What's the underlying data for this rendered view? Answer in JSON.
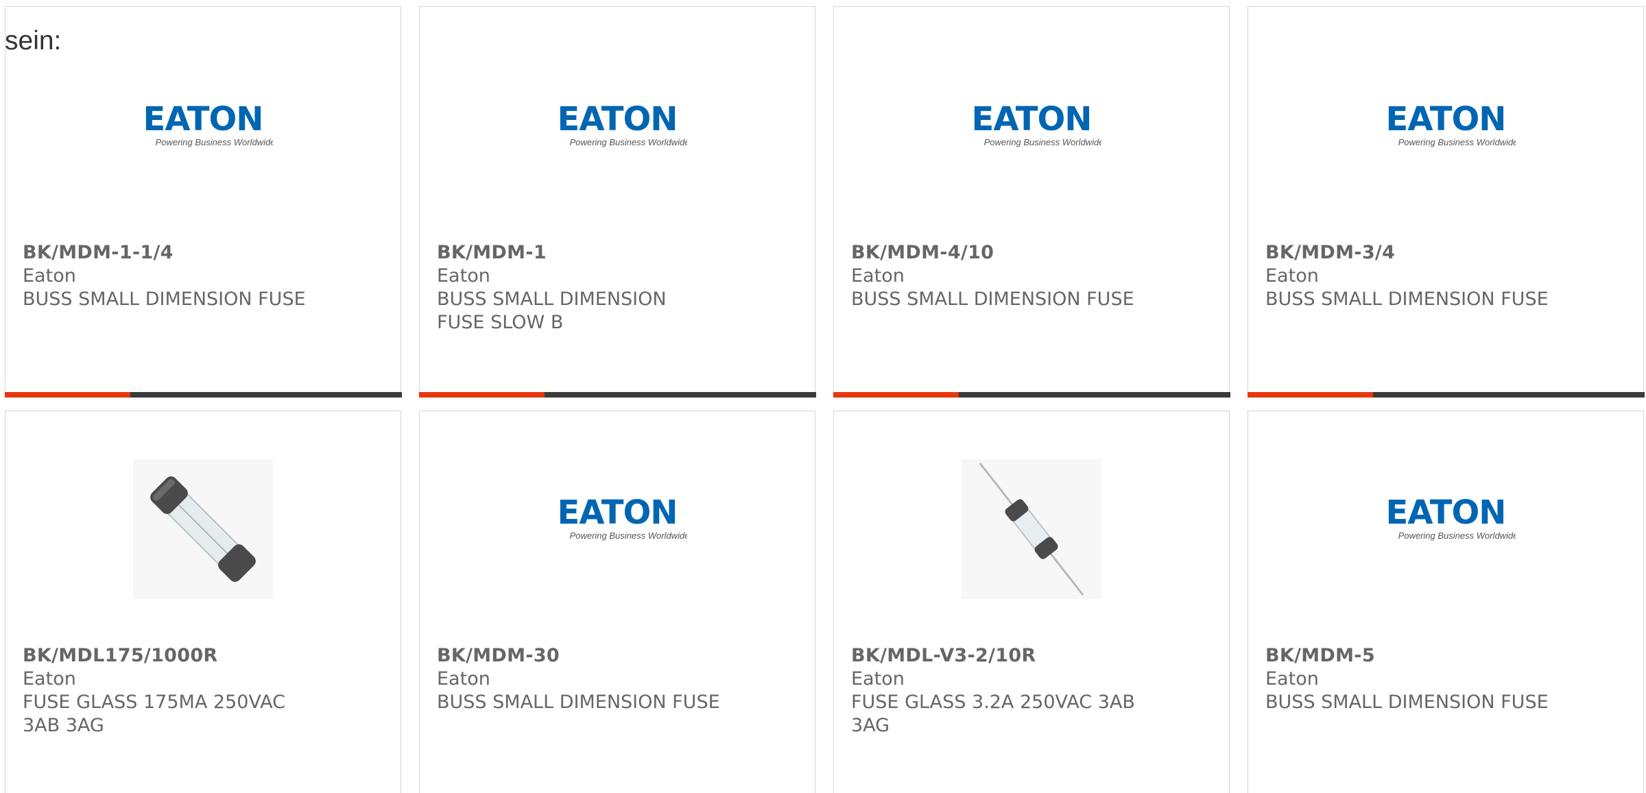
{
  "intro_text": "sein:",
  "colors": {
    "accent": "#e8380d",
    "bar": "#3a3a3a",
    "eaton_blue": "#0066b3"
  },
  "products": [
    {
      "part_number": "BK/MDM-1-1/4",
      "brand": "Eaton",
      "description": "BUSS SMALL DIMENSION FUSE",
      "image": "eaton-logo-icon",
      "logo_word": "EATON",
      "logo_tagline": "Powering Business Worldwide"
    },
    {
      "part_number": "BK/MDM-1",
      "brand": "Eaton",
      "description": "BUSS SMALL DIMENSION FUSE SLOW B",
      "image": "eaton-logo-icon",
      "logo_word": "EATON",
      "logo_tagline": "Powering Business Worldwide"
    },
    {
      "part_number": "BK/MDM-4/10",
      "brand": "Eaton",
      "description": "BUSS SMALL DIMENSION FUSE",
      "image": "eaton-logo-icon",
      "logo_word": "EATON",
      "logo_tagline": "Powering Business Worldwide"
    },
    {
      "part_number": "BK/MDM-3/4",
      "brand": "Eaton",
      "description": "BUSS SMALL DIMENSION FUSE",
      "image": "eaton-logo-icon",
      "logo_word": "EATON",
      "logo_tagline": "Powering Business Worldwide"
    },
    {
      "part_number": "BK/MDL175/1000R",
      "brand": "Eaton",
      "description": "FUSE GLASS 175MA 250VAC 3AB 3AG",
      "image": "glass-fuse-icon"
    },
    {
      "part_number": "BK/MDM-30",
      "brand": "Eaton",
      "description": "BUSS SMALL DIMENSION FUSE",
      "image": "eaton-logo-icon",
      "logo_word": "EATON",
      "logo_tagline": "Powering Business Worldwide"
    },
    {
      "part_number": "BK/MDL-V3-2/10R",
      "brand": "Eaton",
      "description": "FUSE GLASS 3.2A 250VAC 3AB 3AG",
      "image": "axial-glass-fuse-icon"
    },
    {
      "part_number": "BK/MDM-5",
      "brand": "Eaton",
      "description": "BUSS SMALL DIMENSION FUSE",
      "image": "eaton-logo-icon",
      "logo_word": "EATON",
      "logo_tagline": "Powering Business Worldwide"
    }
  ]
}
